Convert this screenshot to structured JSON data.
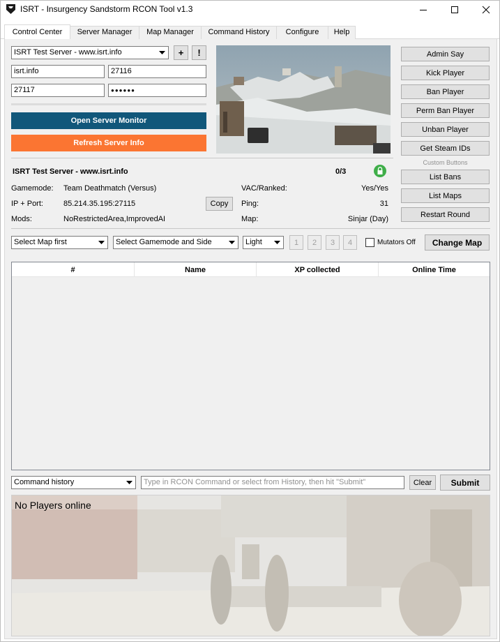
{
  "window": {
    "title": "ISRT - Insurgency Sandstorm RCON Tool v1.3"
  },
  "tabs": [
    {
      "label": "Control Center",
      "active": true
    },
    {
      "label": "Server Manager"
    },
    {
      "label": "Map Manager"
    },
    {
      "label": "Command History"
    },
    {
      "label": "Configure"
    },
    {
      "label": "Help"
    }
  ],
  "server": {
    "selected": "ISRT Test Server - www.isrt.info",
    "add_label": "+",
    "alert_label": "!",
    "host": "isrt.info",
    "query_port": "27116",
    "rcon_port": "27117",
    "password_mask": "●●●●●●"
  },
  "buttons": {
    "open_monitor": "Open Server Monitor",
    "refresh_info": "Refresh Server Info",
    "copy": "Copy",
    "change_map": "Change Map",
    "clear": "Clear",
    "submit": "Submit"
  },
  "colors": {
    "open_monitor": "#11577a",
    "refresh_info": "#fb7532",
    "lock_green": "#3fae49"
  },
  "admin_buttons": [
    "Admin Say",
    "Kick Player",
    "Ban Player",
    "Perm Ban Player",
    "Unban Player",
    "Get Steam IDs"
  ],
  "custom_buttons": {
    "heading": "Custom Buttons",
    "items": [
      "List Bans",
      "List Maps",
      "Restart Round"
    ]
  },
  "info": {
    "server_name": "ISRT Test Server - www.isrt.info",
    "players": "0/3",
    "gamemode_label": "Gamemode:",
    "gamemode": "Team Deathmatch (Versus)",
    "ip_label": "IP + Port:",
    "ip": "85.214.35.195:27115",
    "mods_label": "Mods:",
    "mods": "NoRestrictedArea,ImprovedAI",
    "vac_label": "VAC/Ranked:",
    "vac": "Yes/Yes",
    "ping_label": "Ping:",
    "ping": "31",
    "map_label": "Map:",
    "map": "Sinjar (Day)"
  },
  "map_change": {
    "map_select": "Select Map first",
    "gamemode_select": "Select Gamemode and Side",
    "lighting": "Light",
    "slots": [
      "1",
      "2",
      "3",
      "4"
    ],
    "mutators_label": "Mutators Off"
  },
  "players_table": {
    "columns": [
      "#",
      "Name",
      "XP collected",
      "Online Time"
    ]
  },
  "command": {
    "history_select": "Command history",
    "placeholder": "Type in RCON Command or select from History, then hit \"Submit\""
  },
  "log": {
    "text": "No Players online"
  }
}
